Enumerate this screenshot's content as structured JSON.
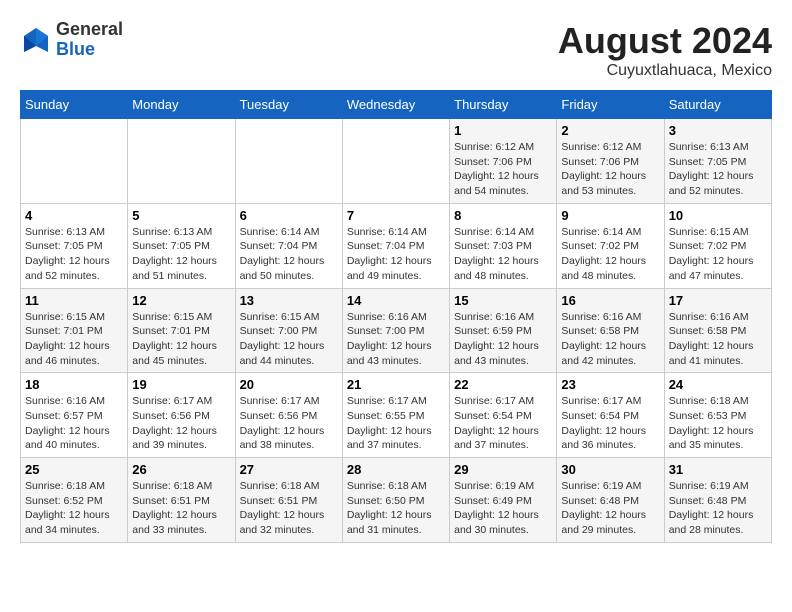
{
  "header": {
    "logo_line1": "General",
    "logo_line2": "Blue",
    "month": "August 2024",
    "location": "Cuyuxtlahuaca, Mexico"
  },
  "weekdays": [
    "Sunday",
    "Monday",
    "Tuesday",
    "Wednesday",
    "Thursday",
    "Friday",
    "Saturday"
  ],
  "weeks": [
    [
      {
        "day": "",
        "info": ""
      },
      {
        "day": "",
        "info": ""
      },
      {
        "day": "",
        "info": ""
      },
      {
        "day": "",
        "info": ""
      },
      {
        "day": "1",
        "info": "Sunrise: 6:12 AM\nSunset: 7:06 PM\nDaylight: 12 hours\nand 54 minutes."
      },
      {
        "day": "2",
        "info": "Sunrise: 6:12 AM\nSunset: 7:06 PM\nDaylight: 12 hours\nand 53 minutes."
      },
      {
        "day": "3",
        "info": "Sunrise: 6:13 AM\nSunset: 7:05 PM\nDaylight: 12 hours\nand 52 minutes."
      }
    ],
    [
      {
        "day": "4",
        "info": "Sunrise: 6:13 AM\nSunset: 7:05 PM\nDaylight: 12 hours\nand 52 minutes."
      },
      {
        "day": "5",
        "info": "Sunrise: 6:13 AM\nSunset: 7:05 PM\nDaylight: 12 hours\nand 51 minutes."
      },
      {
        "day": "6",
        "info": "Sunrise: 6:14 AM\nSunset: 7:04 PM\nDaylight: 12 hours\nand 50 minutes."
      },
      {
        "day": "7",
        "info": "Sunrise: 6:14 AM\nSunset: 7:04 PM\nDaylight: 12 hours\nand 49 minutes."
      },
      {
        "day": "8",
        "info": "Sunrise: 6:14 AM\nSunset: 7:03 PM\nDaylight: 12 hours\nand 48 minutes."
      },
      {
        "day": "9",
        "info": "Sunrise: 6:14 AM\nSunset: 7:02 PM\nDaylight: 12 hours\nand 48 minutes."
      },
      {
        "day": "10",
        "info": "Sunrise: 6:15 AM\nSunset: 7:02 PM\nDaylight: 12 hours\nand 47 minutes."
      }
    ],
    [
      {
        "day": "11",
        "info": "Sunrise: 6:15 AM\nSunset: 7:01 PM\nDaylight: 12 hours\nand 46 minutes."
      },
      {
        "day": "12",
        "info": "Sunrise: 6:15 AM\nSunset: 7:01 PM\nDaylight: 12 hours\nand 45 minutes."
      },
      {
        "day": "13",
        "info": "Sunrise: 6:15 AM\nSunset: 7:00 PM\nDaylight: 12 hours\nand 44 minutes."
      },
      {
        "day": "14",
        "info": "Sunrise: 6:16 AM\nSunset: 7:00 PM\nDaylight: 12 hours\nand 43 minutes."
      },
      {
        "day": "15",
        "info": "Sunrise: 6:16 AM\nSunset: 6:59 PM\nDaylight: 12 hours\nand 43 minutes."
      },
      {
        "day": "16",
        "info": "Sunrise: 6:16 AM\nSunset: 6:58 PM\nDaylight: 12 hours\nand 42 minutes."
      },
      {
        "day": "17",
        "info": "Sunrise: 6:16 AM\nSunset: 6:58 PM\nDaylight: 12 hours\nand 41 minutes."
      }
    ],
    [
      {
        "day": "18",
        "info": "Sunrise: 6:16 AM\nSunset: 6:57 PM\nDaylight: 12 hours\nand 40 minutes."
      },
      {
        "day": "19",
        "info": "Sunrise: 6:17 AM\nSunset: 6:56 PM\nDaylight: 12 hours\nand 39 minutes."
      },
      {
        "day": "20",
        "info": "Sunrise: 6:17 AM\nSunset: 6:56 PM\nDaylight: 12 hours\nand 38 minutes."
      },
      {
        "day": "21",
        "info": "Sunrise: 6:17 AM\nSunset: 6:55 PM\nDaylight: 12 hours\nand 37 minutes."
      },
      {
        "day": "22",
        "info": "Sunrise: 6:17 AM\nSunset: 6:54 PM\nDaylight: 12 hours\nand 37 minutes."
      },
      {
        "day": "23",
        "info": "Sunrise: 6:17 AM\nSunset: 6:54 PM\nDaylight: 12 hours\nand 36 minutes."
      },
      {
        "day": "24",
        "info": "Sunrise: 6:18 AM\nSunset: 6:53 PM\nDaylight: 12 hours\nand 35 minutes."
      }
    ],
    [
      {
        "day": "25",
        "info": "Sunrise: 6:18 AM\nSunset: 6:52 PM\nDaylight: 12 hours\nand 34 minutes."
      },
      {
        "day": "26",
        "info": "Sunrise: 6:18 AM\nSunset: 6:51 PM\nDaylight: 12 hours\nand 33 minutes."
      },
      {
        "day": "27",
        "info": "Sunrise: 6:18 AM\nSunset: 6:51 PM\nDaylight: 12 hours\nand 32 minutes."
      },
      {
        "day": "28",
        "info": "Sunrise: 6:18 AM\nSunset: 6:50 PM\nDaylight: 12 hours\nand 31 minutes."
      },
      {
        "day": "29",
        "info": "Sunrise: 6:19 AM\nSunset: 6:49 PM\nDaylight: 12 hours\nand 30 minutes."
      },
      {
        "day": "30",
        "info": "Sunrise: 6:19 AM\nSunset: 6:48 PM\nDaylight: 12 hours\nand 29 minutes."
      },
      {
        "day": "31",
        "info": "Sunrise: 6:19 AM\nSunset: 6:48 PM\nDaylight: 12 hours\nand 28 minutes."
      }
    ]
  ]
}
